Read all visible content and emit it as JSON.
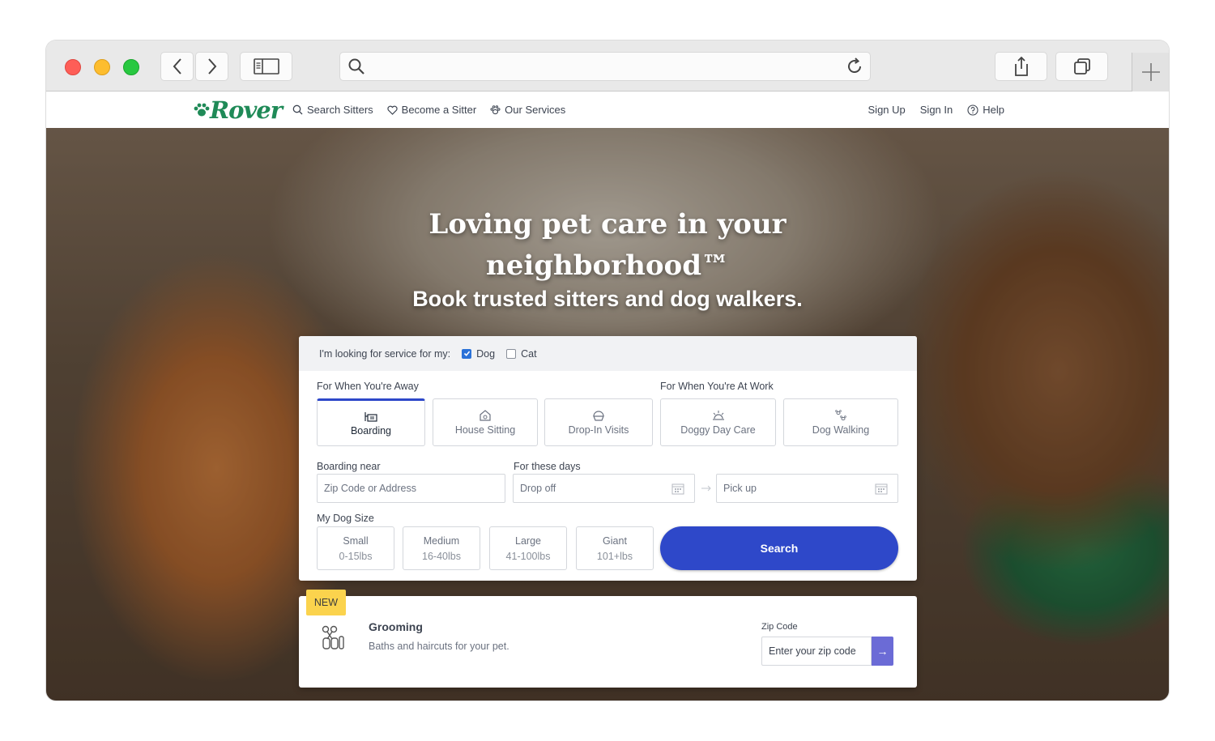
{
  "browser": {
    "url": "",
    "icons": [
      "back-icon",
      "forward-icon",
      "sidebar-icon",
      "search-icon",
      "reload-icon",
      "share-icon",
      "tabs-icon",
      "new-tab-icon"
    ]
  },
  "nav": {
    "logo": "Rover",
    "left": [
      {
        "label": "Search Sitters",
        "icon": "search-icon"
      },
      {
        "label": "Become a Sitter",
        "icon": "heart-icon"
      },
      {
        "label": "Our Services",
        "icon": "paw-icon"
      }
    ],
    "right": [
      {
        "label": "Sign Up"
      },
      {
        "label": "Sign In"
      },
      {
        "label": "Help",
        "icon": "help-icon"
      }
    ]
  },
  "hero": {
    "title_line1": "Loving pet care in your",
    "title_line2": "neighborhood™",
    "subtitle": "Book trusted sitters and dog walkers."
  },
  "search": {
    "looking_for_label": "I'm looking for service for my:",
    "pets": [
      {
        "label": "Dog",
        "checked": true
      },
      {
        "label": "Cat",
        "checked": false
      }
    ],
    "away_label": "For When You're Away",
    "work_label": "For When You're At Work",
    "services": [
      {
        "label": "Boarding",
        "active": true
      },
      {
        "label": "House Sitting",
        "active": false
      },
      {
        "label": "Drop-In Visits",
        "active": false
      },
      {
        "label": "Doggy Day Care",
        "active": false
      },
      {
        "label": "Dog Walking",
        "active": false
      }
    ],
    "near_label": "Boarding near",
    "near_placeholder": "Zip Code or Address",
    "days_label": "For these days",
    "dropoff_placeholder": "Drop off",
    "pickup_placeholder": "Pick up",
    "size_label": "My Dog Size",
    "sizes": [
      {
        "label": "Small",
        "range": "0-15lbs"
      },
      {
        "label": "Medium",
        "range": "16-40lbs"
      },
      {
        "label": "Large",
        "range": "41-100lbs"
      },
      {
        "label": "Giant",
        "range": "101+lbs"
      }
    ],
    "search_button": "Search"
  },
  "grooming": {
    "badge": "NEW",
    "title": "Grooming",
    "subtitle": "Baths and haircuts for your pet.",
    "zip_label": "Zip Code",
    "zip_placeholder": "Enter your zip code",
    "go_arrow": "→"
  },
  "colors": {
    "brand_green": "#1f8a57",
    "primary_blue": "#2e48c9",
    "badge_yellow": "#fbd34d",
    "go_button": "#6b6bd6"
  }
}
